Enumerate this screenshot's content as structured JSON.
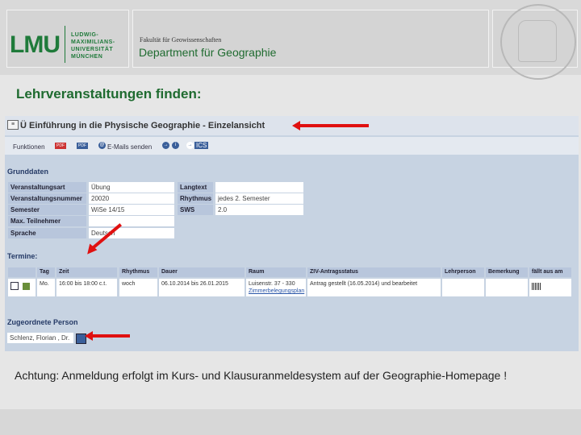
{
  "header": {
    "logo": "LMU",
    "university": [
      "LUDWIG-",
      "MAXIMILIANS-",
      "UNIVERSITÄT",
      "MÜNCHEN"
    ],
    "faculty": "Fakultät für Geowissenschaften",
    "department": "Department für Geographie"
  },
  "heading": "Lehrveranstaltungen finden:",
  "screenshot": {
    "title": "Ü Einführung in die Physische Geographie - Einzelansicht",
    "toolbar": {
      "funktionen": "Funktionen",
      "pdf1": "PDF",
      "pdf2": "PDF",
      "email": "E-Mails senden",
      "nav_arrow": "→",
      "nav_info": "i",
      "nav_ics": "ICS"
    },
    "grunddaten": {
      "title": "Grunddaten",
      "left": [
        {
          "label": "Veranstaltungsart",
          "value": "Übung"
        },
        {
          "label": "Veranstaltungsnummer",
          "value": "20020"
        },
        {
          "label": "Semester",
          "value": "WiSe 14/15"
        },
        {
          "label": "Max. Teilnehmer",
          "value": ""
        },
        {
          "label": "Sprache",
          "value": "Deutsch"
        }
      ],
      "right": [
        {
          "label": "Langtext",
          "value": ""
        },
        {
          "label": "Rhythmus",
          "value": "jedes 2. Semester"
        },
        {
          "label": "SWS",
          "value": "2.0"
        }
      ]
    },
    "termine": {
      "title": "Termine:",
      "headers": [
        "Tag",
        "Zeit",
        "Rhythmus",
        "Dauer",
        "Raum",
        "ZIV-Antragsstatus",
        "Lehrperson",
        "Bemerkung",
        "fällt aus am"
      ],
      "row": {
        "tag": "Mo.",
        "zeit": "16:00 bis 18:00 c.t.",
        "rhythmus": "woch",
        "dauer": "06.10.2014 bis 26.01.2015",
        "raum": "Luisenstr. 37 - 330",
        "raum_link": "Zimmerbelegungsplan",
        "status": "Antrag gestellt (16.05.2014) und bearbeitet",
        "lehrperson": "",
        "bemerkung": "",
        "faellt_aus": ""
      }
    },
    "person": {
      "title": "Zugeordnete Person",
      "name": "Schlenz, Florian , Dr."
    }
  },
  "note": "Achtung: Anmeldung erfolgt im Kurs- und Klausuranmeldesystem auf der Geographie-Homepage !",
  "colors": {
    "lmu_green": "#1f7a3a",
    "arrow_red": "#e01010",
    "table_label_bg": "#b8c6dc"
  }
}
